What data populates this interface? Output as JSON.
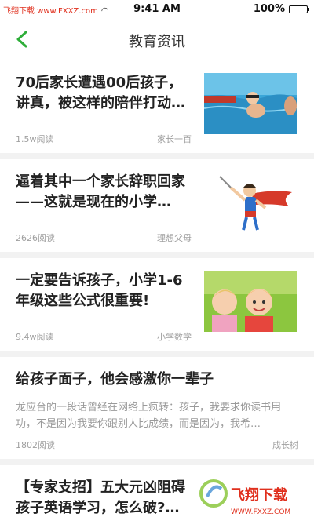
{
  "status_bar": {
    "carrier": "飞翔下载 www.FXXZ.com",
    "time": "9:41 AM",
    "battery_text": "100%",
    "battery_level": 1.0
  },
  "nav": {
    "title": "教育资讯"
  },
  "articles": [
    {
      "title": "70后家长遭遇00后孩子，讲真，被这样的陪伴打动…",
      "reads": "1.5w阅读",
      "source": "家长一百"
    },
    {
      "title": "逼着其中一个家长辞职回家——这就是现在的小学…",
      "reads": "2626阅读",
      "source": "理想父母"
    },
    {
      "title": "一定要告诉孩子，小学1-6年级这些公式很重要!",
      "reads": "9.4w阅读",
      "source": "小学数学"
    },
    {
      "title": "给孩子面子，他会感激你一辈子",
      "summary": "龙应台的一段话曾经在网络上疯转：孩子，我要求你读书用功，不是因为我要你跟别人比成绩，而是因为，我希…",
      "reads": "1802阅读",
      "source": "成长树"
    },
    {
      "title": "【专家支招】五大元凶阻碍孩子英语学习，怎么破?…"
    }
  ],
  "watermark": {
    "brand": "飞翔下载",
    "url": "WWW.FXXZ.COM"
  },
  "colors": {
    "accent": "#2fae3a",
    "watermark_red": "#e0301e"
  }
}
